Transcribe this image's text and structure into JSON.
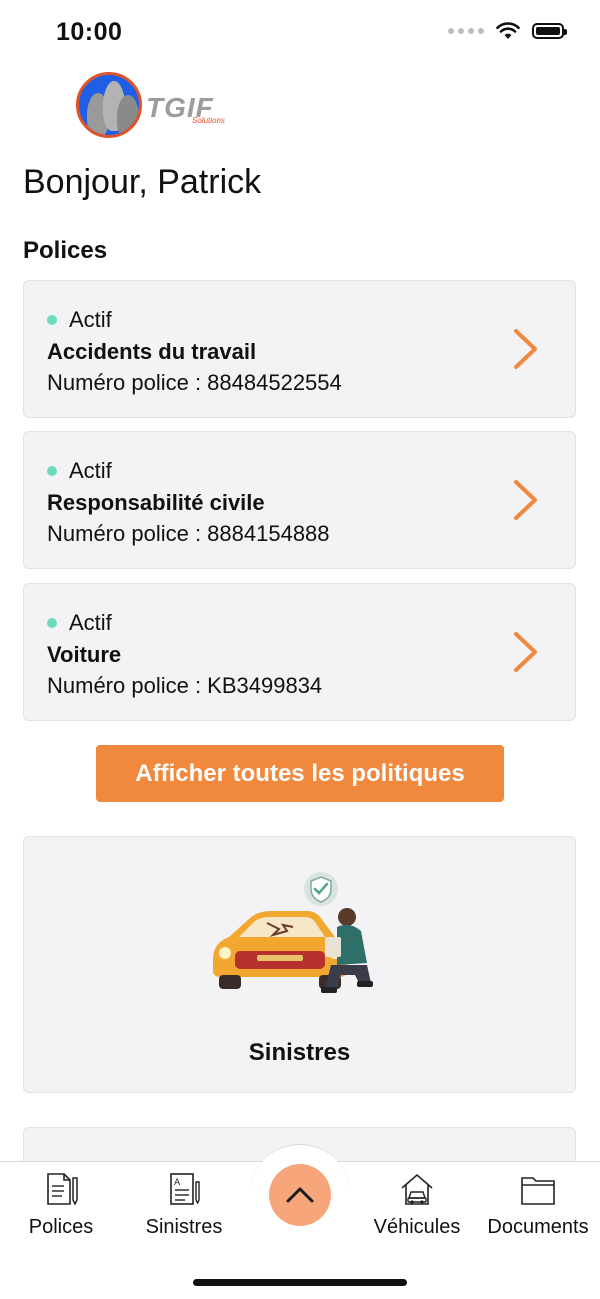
{
  "status_bar": {
    "time": "10:00"
  },
  "logo": {
    "text": "TGIF",
    "subtext": "Solutions"
  },
  "greeting": "Bonjour, Patrick",
  "policies_section": {
    "title": "Polices",
    "items": [
      {
        "status": "Actif",
        "name": "Accidents du travail",
        "number": "Numéro police : 88484522554"
      },
      {
        "status": "Actif",
        "name": "Responsabilité civile",
        "number": "Numéro police : 8884154888"
      },
      {
        "status": "Actif",
        "name": "Voiture",
        "number": "Numéro police : KB3499834"
      }
    ],
    "show_all_label": "Afficher toutes les politiques"
  },
  "claims_card": {
    "label": "Sinistres"
  },
  "tab_bar": {
    "tabs": [
      {
        "label": "Polices",
        "icon": "document-pen-icon"
      },
      {
        "label": "Sinistres",
        "icon": "claim-document-icon"
      },
      {
        "label": "Véhicules",
        "icon": "house-car-icon"
      },
      {
        "label": "Documents",
        "icon": "folder-icon"
      }
    ],
    "center_button_icon": "chevron-up-icon"
  },
  "colors": {
    "accent": "#f0883e",
    "active_dot": "#6cdbc0",
    "card_bg": "#f3f3f5",
    "fab": "#f7a67c"
  }
}
